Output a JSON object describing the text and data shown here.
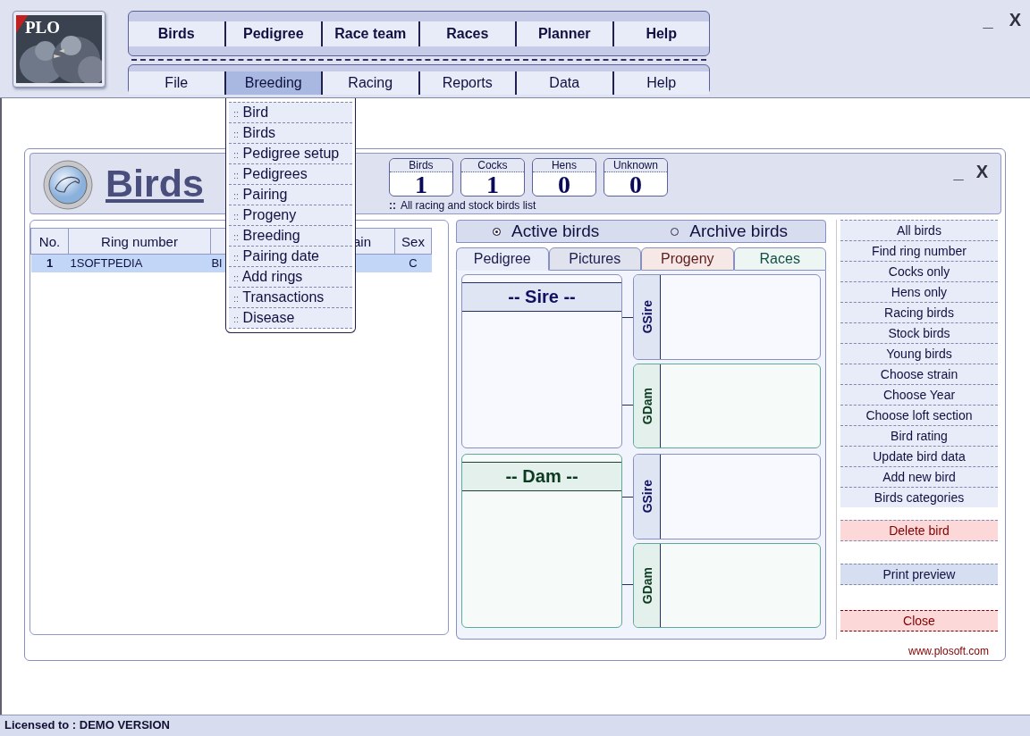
{
  "app_header": {
    "logo_text": "PLO",
    "primary_menu": [
      "Birds",
      "Pedigree",
      "Race team",
      "Races",
      "Planner",
      "Help"
    ],
    "secondary_menu": [
      {
        "label": "File",
        "selected": false
      },
      {
        "label": "Breeding",
        "selected": true
      },
      {
        "label": "Racing",
        "selected": false
      },
      {
        "label": "Reports",
        "selected": false
      },
      {
        "label": "Data",
        "selected": false
      },
      {
        "label": "Help",
        "selected": false
      }
    ],
    "window_controls": [
      "_",
      "X"
    ]
  },
  "dropdown_menu": {
    "items": [
      {
        "bullet": "::",
        "label": "Bird"
      },
      {
        "bullet": "::",
        "label": "Birds"
      },
      {
        "bullet": "::",
        "label": "Pedigree setup"
      },
      {
        "bullet": "::",
        "label": "Pedigrees"
      },
      {
        "bullet": "::",
        "label": "Pairing"
      },
      {
        "bullet": "::",
        "label": "Progeny"
      },
      {
        "bullet": "::",
        "label": "Breeding"
      },
      {
        "bullet": "::",
        "label": "Pairing date"
      },
      {
        "bullet": "::",
        "label": "Add rings"
      },
      {
        "bullet": "::",
        "label": "Transactions"
      },
      {
        "bullet": "::",
        "label": "Disease"
      }
    ]
  },
  "birds_window": {
    "title": "Birds",
    "window_controls": [
      "_",
      "X"
    ],
    "counters": [
      {
        "label": "Birds",
        "value": "1"
      },
      {
        "label": "Cocks",
        "value": "1"
      },
      {
        "label": "Hens",
        "value": "0"
      },
      {
        "label": "Unknown",
        "value": "0"
      }
    ],
    "subtitle_bullet": "::",
    "subtitle": "All racing and stock birds list",
    "table": {
      "columns": {
        "no": "No.",
        "ring_number": "Ring number",
        "column_4": "ain",
        "sex": "Sex"
      },
      "rows": [
        {
          "selected": true,
          "cells": {
            "no": "1",
            "ring_number": "1SOFTPEDIA",
            "column_3": "Bl",
            "sex": "C"
          }
        }
      ]
    },
    "filter": [
      {
        "label": "Active birds",
        "selected": true
      },
      {
        "label": "Archive birds",
        "selected": false
      }
    ],
    "tabs": [
      {
        "label": "Pedigree",
        "selected": true,
        "color": "#e8ecf8"
      },
      {
        "label": "Pictures",
        "selected": false,
        "color": "#e0e2ee"
      },
      {
        "label": "Progeny",
        "selected": false,
        "color": "#f6e8e6"
      },
      {
        "label": "Races",
        "selected": false,
        "color": "#eef6f4"
      }
    ],
    "pedigree": [
      {
        "kind": "male",
        "title": "-- Sire --",
        "ancestors": [
          {
            "kind": "male",
            "label": "GSire"
          },
          {
            "kind": "female",
            "label": "GDam"
          }
        ]
      },
      {
        "kind": "female",
        "title": "-- Dam --",
        "ancestors": [
          {
            "kind": "male",
            "label": "GSire"
          },
          {
            "kind": "female",
            "label": "GDam"
          }
        ]
      }
    ],
    "actions": [
      {
        "label": "All birds",
        "kind": "normal"
      },
      {
        "label": "Find ring number",
        "kind": "normal"
      },
      {
        "label": "Cocks only",
        "kind": "normal"
      },
      {
        "label": "Hens only",
        "kind": "normal"
      },
      {
        "label": "Racing birds",
        "kind": "normal"
      },
      {
        "label": "Stock birds",
        "kind": "normal"
      },
      {
        "label": "Young birds",
        "kind": "normal"
      },
      {
        "label": "Choose strain",
        "kind": "normal"
      },
      {
        "label": "Choose Year",
        "kind": "normal"
      },
      {
        "label": "Choose loft section",
        "kind": "normal"
      },
      {
        "label": "Bird rating",
        "kind": "normal"
      },
      {
        "label": "Update bird data",
        "kind": "normal"
      },
      {
        "label": "Add new bird",
        "kind": "normal"
      },
      {
        "label": "Birds categories",
        "kind": "normal"
      },
      {
        "label": "Delete bird",
        "kind": "danger"
      },
      {
        "label": "Print preview",
        "kind": "print"
      },
      {
        "label": "Close",
        "kind": "close"
      }
    ],
    "link": "www.plosoft.com"
  },
  "status_bar": "Licensed to : DEMO VERSION"
}
